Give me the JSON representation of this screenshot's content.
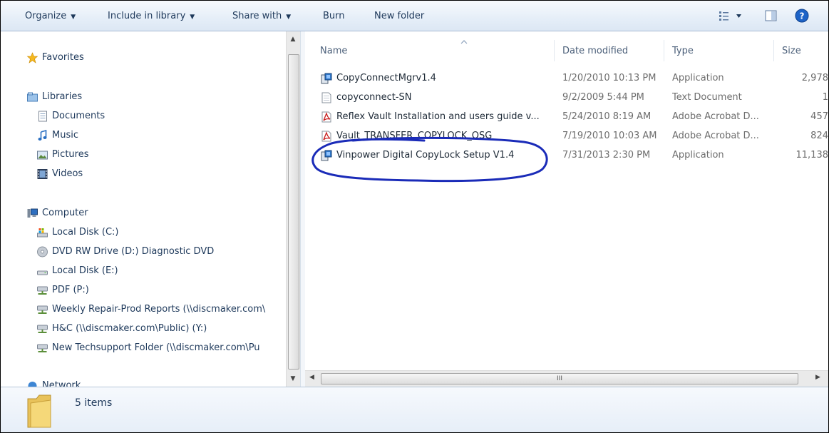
{
  "toolbar": {
    "organize": "Organize",
    "include_in_library": "Include in library",
    "share_with": "Share with",
    "burn": "Burn",
    "new_folder": "New folder"
  },
  "nav": {
    "favorites": "Favorites",
    "libraries": "Libraries",
    "library_items": [
      "Documents",
      "Music",
      "Pictures",
      "Videos"
    ],
    "computer": "Computer",
    "drives": [
      "Local Disk (C:)",
      "DVD RW Drive (D:) Diagnostic DVD",
      "Local Disk (E:)",
      "PDF (P:)",
      "Weekly Repair-Prod Reports (\\\\discmaker.com\\",
      "H&C (\\\\discmaker.com\\Public) (Y:)",
      "New Techsupport Folder (\\\\discmaker.com\\Pu"
    ],
    "network_partial": "Network"
  },
  "columns": {
    "name": "Name",
    "date_modified": "Date modified",
    "type": "Type",
    "size": "Size"
  },
  "files": [
    {
      "name": "CopyConnectMgrv1.4",
      "date": "1/20/2010 10:13 PM",
      "type": "Application",
      "size": "2,978",
      "icon": "installer-icon"
    },
    {
      "name": "copyconnect-SN",
      "date": "9/2/2009 5:44 PM",
      "type": "Text Document",
      "size": "1",
      "icon": "text-document-icon"
    },
    {
      "name": "Reflex Vault Installation and users guide v...",
      "date": "5/24/2010 8:19 AM",
      "type": "Adobe Acrobat D...",
      "size": "457",
      "icon": "pdf-icon"
    },
    {
      "name": "Vault_TRANSFER_COPYLOCK_QSG",
      "date": "7/19/2010 10:03 AM",
      "type": "Adobe Acrobat D...",
      "size": "824",
      "icon": "pdf-icon"
    },
    {
      "name": "Vinpower Digital CopyLock Setup V1.4",
      "date": "7/31/2013 2:30 PM",
      "type": "Application",
      "size": "11,138",
      "icon": "installer-icon"
    }
  ],
  "details": {
    "item_count": "5 items"
  },
  "scrollbar": {
    "grip": "III"
  },
  "colors": {
    "annotation_circle": "#1a2bb8",
    "toolbar_text": "#1e395b"
  }
}
